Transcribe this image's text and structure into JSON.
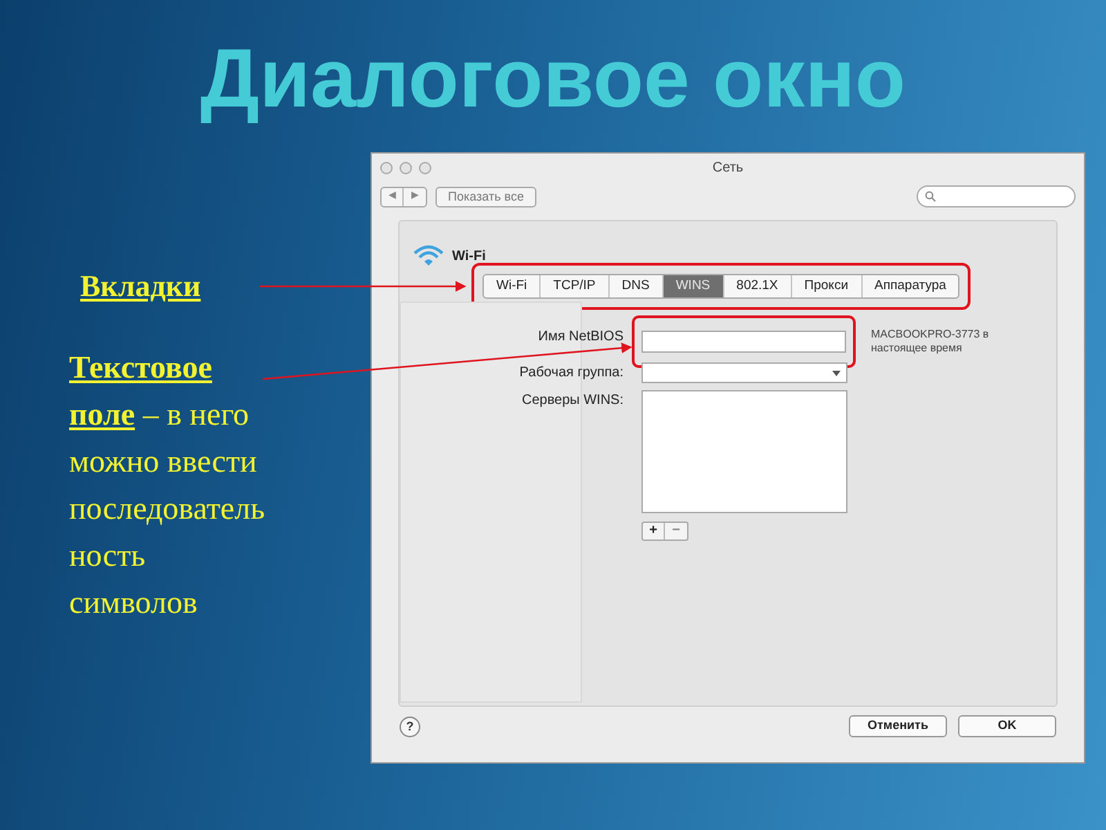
{
  "slide": {
    "title": "Диалоговое окно",
    "callouts": [
      {
        "text": "Вкладки"
      },
      {
        "text": "**Текстовое поле** – в него можно ввести последователь ность символов"
      }
    ]
  },
  "dialog": {
    "window": {
      "title": "Сеть"
    },
    "toolbar": {
      "back": "◀",
      "forward": "▶",
      "show_all": "Показать все"
    },
    "service": "Wi-Fi",
    "tabs": [
      {
        "label": "Wi-Fi",
        "selected": false
      },
      {
        "label": "TCP/IP",
        "selected": false
      },
      {
        "label": "DNS",
        "selected": false
      },
      {
        "label": "WINS",
        "selected": true
      },
      {
        "label": "802.1X",
        "selected": false
      },
      {
        "label": "Прокси",
        "selected": false
      },
      {
        "label": "Аппаратура",
        "selected": false
      }
    ],
    "fields": [
      {
        "label": "Имя NetBIOS",
        "kind": "text"
      },
      {
        "label": "Рабочая группа:",
        "kind": "dropdown"
      },
      {
        "label": "Серверы WINS:",
        "kind": "list"
      }
    ],
    "note": "MACBOOKPRO-3773 в настоящее время",
    "list_buttons": [
      "+",
      "−"
    ],
    "help": "?",
    "buttons": [
      "Отменить",
      "OK"
    ]
  }
}
